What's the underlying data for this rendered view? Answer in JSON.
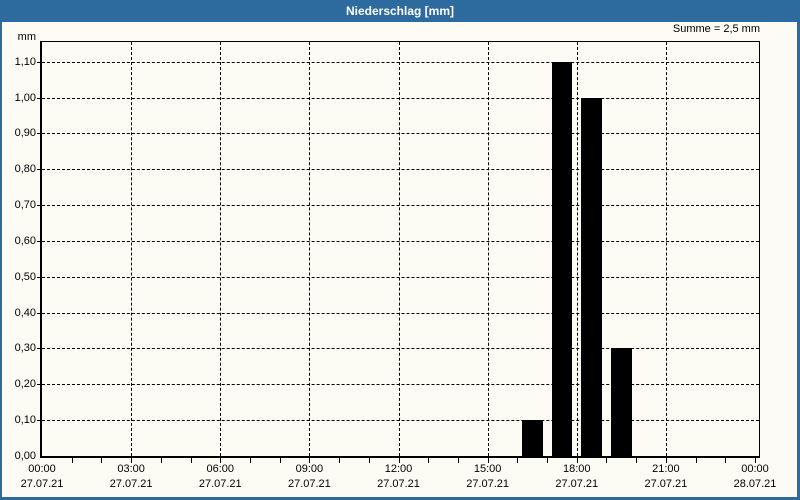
{
  "window": {
    "title": "Niederschlag [mm]"
  },
  "header": {
    "sum_label": "Summe = 2,5 mm"
  },
  "chart_data": {
    "type": "bar",
    "title": "Niederschlag [mm]",
    "ylabel": "mm",
    "summary_annotation": "Summe = 2,5 mm",
    "total_mm": 2.5,
    "grid": "dashed, horizontal every 0.10 mm, vertical every 3 h",
    "legend_position": "none",
    "ylim": [
      0,
      1.155
    ],
    "xlim_hours": [
      0,
      24.134
    ],
    "y_ticks": [
      {
        "value": 0.0,
        "label": "0,00"
      },
      {
        "value": 0.1,
        "label": "0,10"
      },
      {
        "value": 0.2,
        "label": "0,20"
      },
      {
        "value": 0.3,
        "label": "0,30"
      },
      {
        "value": 0.4,
        "label": "0,40"
      },
      {
        "value": 0.5,
        "label": "0,50"
      },
      {
        "value": 0.6,
        "label": "0,60"
      },
      {
        "value": 0.7,
        "label": "0,70"
      },
      {
        "value": 0.8,
        "label": "0,80"
      },
      {
        "value": 0.9,
        "label": "0,90"
      },
      {
        "value": 1.0,
        "label": "1,00"
      },
      {
        "value": 1.1,
        "label": "1,10"
      }
    ],
    "x_ticks": [
      {
        "hour": 0,
        "time": "00:00",
        "date": "27.07.21"
      },
      {
        "hour": 3,
        "time": "03:00",
        "date": "27.07.21"
      },
      {
        "hour": 6,
        "time": "06:00",
        "date": "27.07.21"
      },
      {
        "hour": 9,
        "time": "09:00",
        "date": "27.07.21"
      },
      {
        "hour": 12,
        "time": "12:00",
        "date": "27.07.21"
      },
      {
        "hour": 15,
        "time": "15:00",
        "date": "27.07.21"
      },
      {
        "hour": 18,
        "time": "18:00",
        "date": "27.07.21"
      },
      {
        "hour": 21,
        "time": "21:00",
        "date": "27.07.21"
      },
      {
        "hour": 24,
        "time": "00:00",
        "date": "28.07.21"
      }
    ],
    "minor_x_tick_every_hours": 1,
    "bars": [
      {
        "start_hour": 16,
        "end_hour": 17,
        "value": 0.1,
        "label": "0,10 mm"
      },
      {
        "start_hour": 17,
        "end_hour": 18,
        "value": 1.1,
        "label": "1,10 mm"
      },
      {
        "start_hour": 18,
        "end_hour": 19,
        "value": 1.0,
        "label": "1,00 mm"
      },
      {
        "start_hour": 19,
        "end_hour": 20,
        "value": 0.3,
        "label": "0,30 mm"
      }
    ]
  },
  "colors": {
    "frame_blue": "#2D6A9D",
    "background": "#FCFCF4",
    "bar": "#000000",
    "grid": "#000000",
    "title_text": "#FFFFFF",
    "text": "#000000"
  }
}
